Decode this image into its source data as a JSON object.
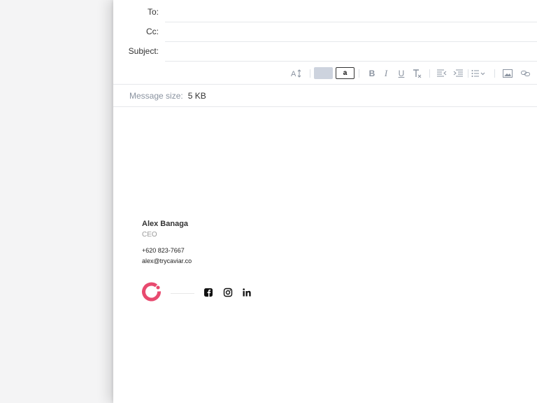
{
  "compose": {
    "fields": {
      "to_label": "To:",
      "to_value": "",
      "cc_label": "Cc:",
      "cc_value": "",
      "subject_label": "Subject:",
      "subject_value": ""
    },
    "toolbar": {
      "font_size_icon": "font-size-icon",
      "text_color_icon": "text-color-swatch",
      "bg_color_label": "a",
      "bold_label": "B",
      "italic_label": "I",
      "underline_label": "U",
      "clear_format_label": "T",
      "items": [
        "font-size-icon",
        "text-color-swatch",
        "background-color-swatch",
        "bold-icon",
        "italic-icon",
        "underline-icon",
        "clear-format-icon",
        "outdent-icon",
        "indent-icon",
        "list-icon",
        "image-icon",
        "link-icon"
      ]
    },
    "message_size": {
      "label": "Message size:",
      "value": "5 KB"
    },
    "signature": {
      "name": "Alex Banaga",
      "role": "CEO",
      "phone": "+620 823-7667",
      "email": "alex@trycaviar.co",
      "logo_color": "#e84a6f",
      "socials": [
        "facebook-icon",
        "instagram-icon",
        "linkedin-icon"
      ]
    }
  }
}
